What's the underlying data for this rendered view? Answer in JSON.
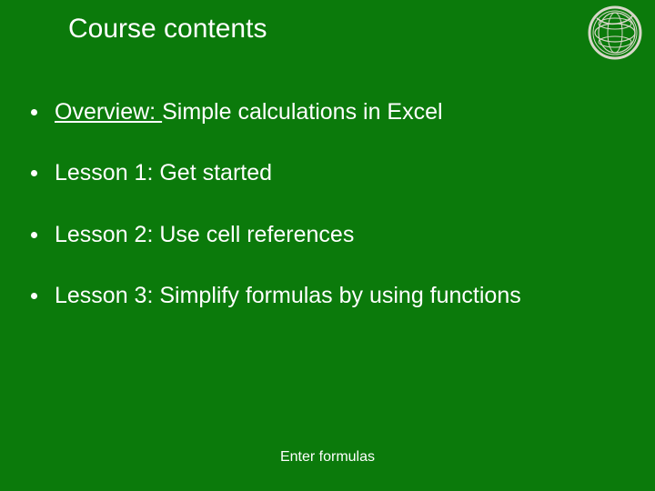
{
  "slide": {
    "title": "Course contents",
    "footer": "Enter formulas"
  },
  "bullets": [
    {
      "link": "Overview: ",
      "rest": "Simple calculations in Excel"
    },
    {
      "link": "",
      "rest": "Lesson 1: Get started"
    },
    {
      "link": "",
      "rest": "Lesson 2: Use cell references"
    },
    {
      "link": "",
      "rest": "Lesson 3: Simplify formulas by using functions"
    }
  ]
}
